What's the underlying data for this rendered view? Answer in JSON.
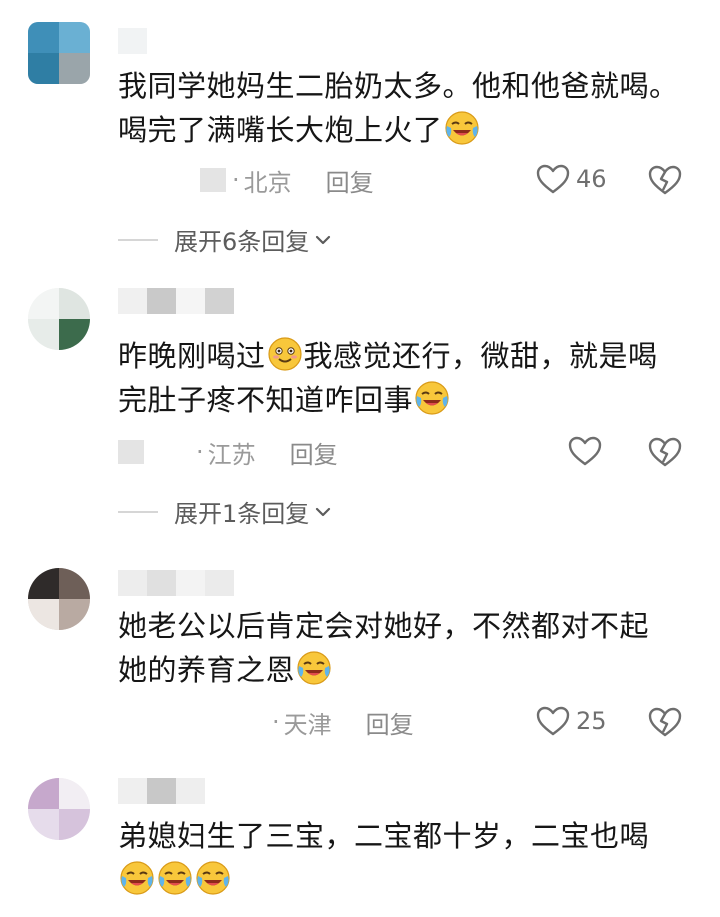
{
  "comments": [
    {
      "text_line1": "我同学她妈生二胎奶太多。他和他爸就喝。",
      "text_line2": "喝完了满嘴长大炮上火了",
      "location": "北京",
      "reply_label": "回复",
      "likes": "46",
      "expand_label": "展开6条回复"
    },
    {
      "text_line1_a": "昨晚刚喝过",
      "text_line1_b": "我感觉还行，微甜，就是喝",
      "text_line2": "完肚子疼不知道咋回事",
      "location": "江苏",
      "reply_label": "回复",
      "likes": "",
      "expand_label": "展开1条回复"
    },
    {
      "text_line1": "她老公以后肯定会对她好，不然都对不起",
      "text_line2": "她的养育之恩",
      "location": "天津",
      "reply_label": "回复",
      "likes": "25"
    },
    {
      "text_line1": "弟媳妇生了三宝，二宝都十岁，二宝也喝",
      "text_line2": ""
    }
  ],
  "icons": {
    "like": "heart-outline-icon",
    "dislike": "broken-heart-icon",
    "expand": "chevron-down-icon",
    "emoji_cry": "laughing-crying-face-emoji",
    "emoji_smile": "blushing-smile-face-emoji"
  }
}
